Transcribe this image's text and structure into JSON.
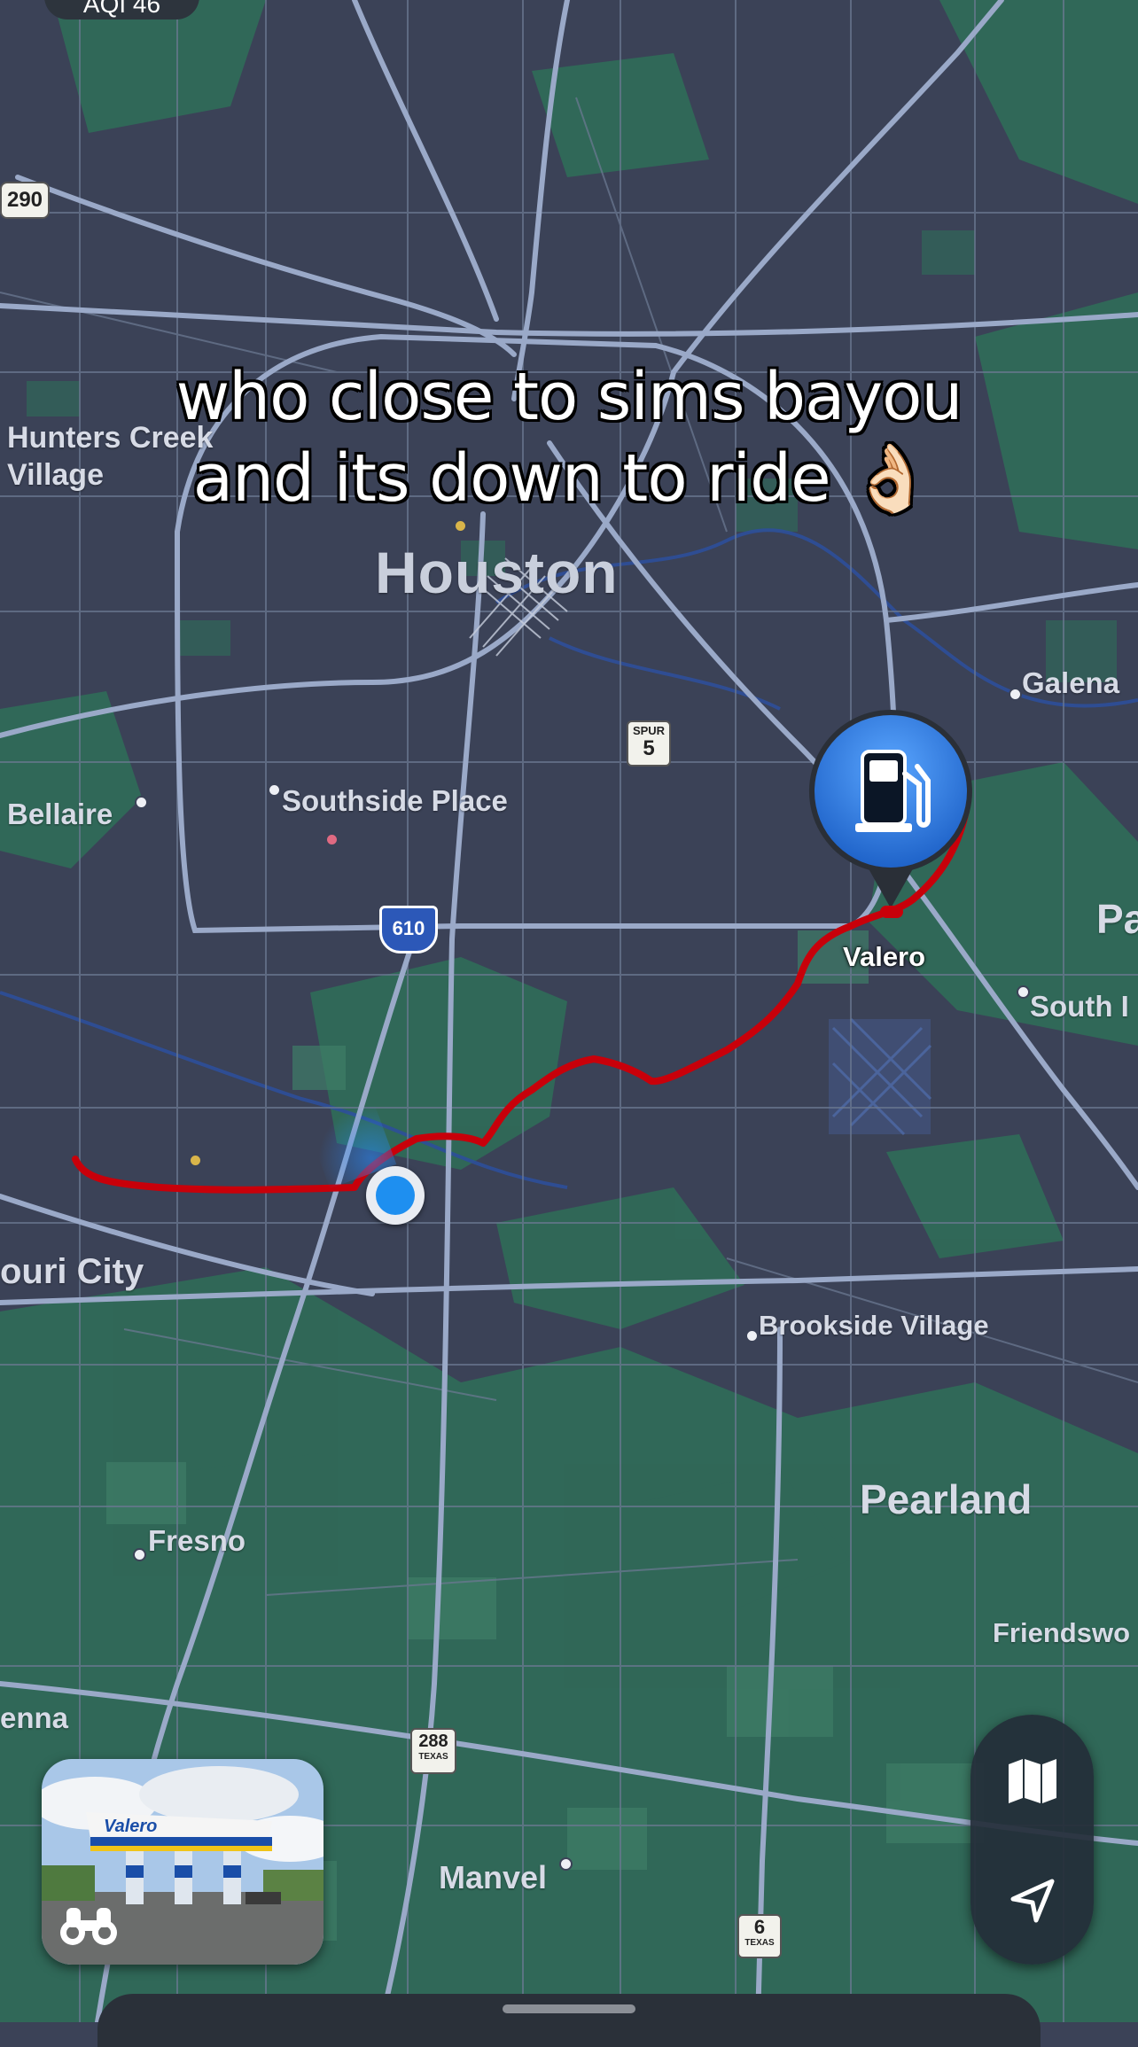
{
  "status": {
    "aqi_label": "AQI 46"
  },
  "caption": {
    "line1": "who close to sims bayou",
    "line2": "and its down to ride 👌🏻"
  },
  "map": {
    "city": "Houston",
    "places": {
      "hunters_creek_1": "Hunters Creek",
      "hunters_creek_2": "Village",
      "galena": "Galena",
      "bellaire": "Bellaire",
      "southside_place": "Southside Place",
      "pa_cut": "Pa",
      "south_cut": "South I",
      "missouri_city_cut": "ouri City",
      "brookside_village": "Brookside Village",
      "pearland": "Pearland",
      "fresno": "Fresno",
      "friendswood_cut": "Friendswo",
      "enna_cut": "enna",
      "manvel": "Manvel"
    },
    "shields": {
      "us290": "290",
      "spur_top": "SPUR",
      "spur_num": "5",
      "i610": "610",
      "tx288_num": "288",
      "tx288_state": "TEXAS",
      "tx6_num": "6",
      "tx6_state": "TEXAS"
    },
    "poi": {
      "name": "Valero",
      "icon": "fuel-pump-icon",
      "color": "#2f7ee0"
    },
    "route_color": "#c8000a"
  },
  "lookaround": {
    "sign_text": "Valero",
    "icon": "binoculars-icon"
  },
  "controls": {
    "map_icon": "map-icon",
    "location_icon": "location-arrow-icon"
  }
}
